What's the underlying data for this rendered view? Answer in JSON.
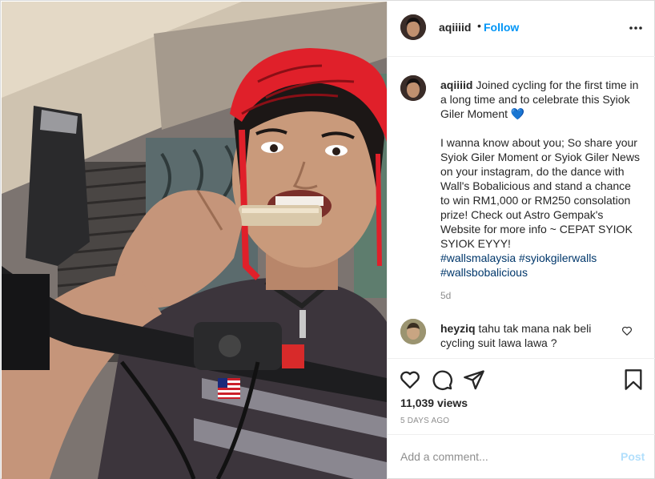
{
  "header": {
    "username": "aqiiiid",
    "separator": "•",
    "follow_label": "Follow",
    "more_icon": "more-options-icon"
  },
  "caption": {
    "username": "aqiiiid",
    "line1": "Joined cycling for the first time in a long time and to celebrate this Syiok Giler Moment",
    "emoji": "💙",
    "body": "I wanna know about you; So share your Syiok Giler Moment or Syiok Giler News on your instagram, do the dance with Wall's Bobalicious and stand a chance to win RM1,000 or RM250 consolation prize! Check out Astro Gempak's Website for more info ~ CEPAT SYIOK SYIOK EYYY!",
    "hashtags": [
      "#wallsmalaysia",
      "#syiokgilerwalls",
      "#wallsbobalicious"
    ],
    "age": "5d"
  },
  "comments": [
    {
      "username": "heyziq",
      "text": "tahu tak mana nak beli cycling suit lawa lawa ?"
    }
  ],
  "actions": {
    "icons": [
      "heart-icon",
      "comment-icon",
      "share-icon",
      "bookmark-icon"
    ],
    "views": "11,039 views",
    "timestamp": "5 DAYS AGO"
  },
  "add_comment": {
    "placeholder": "Add a comment...",
    "post_label": "Post"
  },
  "colors": {
    "link_blue": "#0095f6",
    "hashtag_blue": "#00376b",
    "post_disabled": "#b2dffc",
    "muted": "#8e8e8e",
    "helmet_red": "#e0202a"
  }
}
